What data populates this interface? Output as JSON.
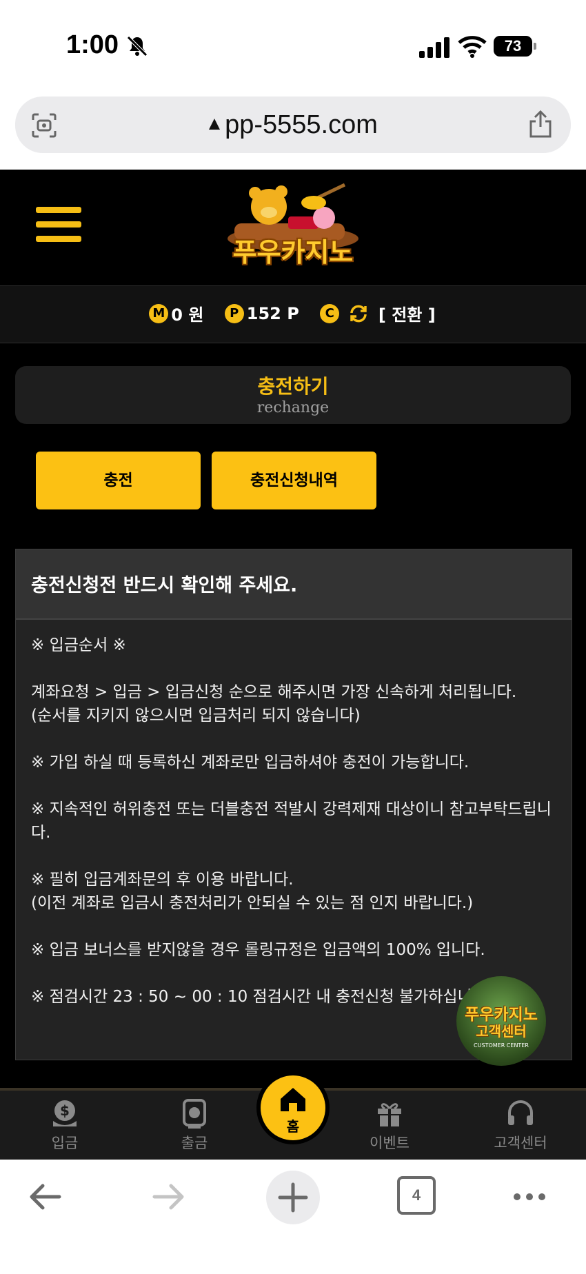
{
  "status": {
    "time": "1:00",
    "battery": "73"
  },
  "browser": {
    "url": "pp-5555.com",
    "tab_count": "4"
  },
  "site": {
    "logo_text": "푸우카지노"
  },
  "balance": {
    "money_badge": "M",
    "money": "0 원",
    "point_badge": "P",
    "points": "152 P",
    "convert_badge": "C",
    "convert_label": "[ 전환 ]"
  },
  "page": {
    "title": "충전하기",
    "subtitle": "rechange"
  },
  "tabs": {
    "charge": "충전",
    "history": "충전신청내역"
  },
  "notice": {
    "title": "충전신청전 반드시 확인해 주세요.",
    "lines": [
      "※ 입금순서 ※",
      "계좌요청 > 입금 > 입금신청 순으로 해주시면 가장 신속하게 처리됩니다.\n(순서를 지키지 않으시면 입금처리 되지 않습니다)",
      "※ 가입 하실 때 등록하신 계좌로만 입금하셔야 충전이 가능합니다.",
      "※ 지속적인 허위충전 또는 더블충전 적발시 강력제재 대상이니 참고부탁드립니다.",
      "※ 필히 입금계좌문의 후 이용 바랍니다.\n(이전 계좌로 입금시 충전처리가 안되실 수 있는 점 인지 바랍니다.)",
      "※ 입금 보너스를 받지않을 경우 롤링규정은 입금액의 100% 입니다.",
      "※ 점검시간 23 : 50 ~ 00 : 10 점검시간 내 충전신청 불가하십니다."
    ]
  },
  "support_badge": {
    "title": "푸우카지노",
    "subtitle": "고객센터",
    "en": "CUSTOMER CENTER"
  },
  "nav": {
    "deposit": "입금",
    "withdraw": "출금",
    "home": "홈",
    "event": "이벤트",
    "support": "고객센터"
  },
  "colors": {
    "accent": "#fcc113",
    "background": "#000000",
    "panel": "#232323"
  }
}
